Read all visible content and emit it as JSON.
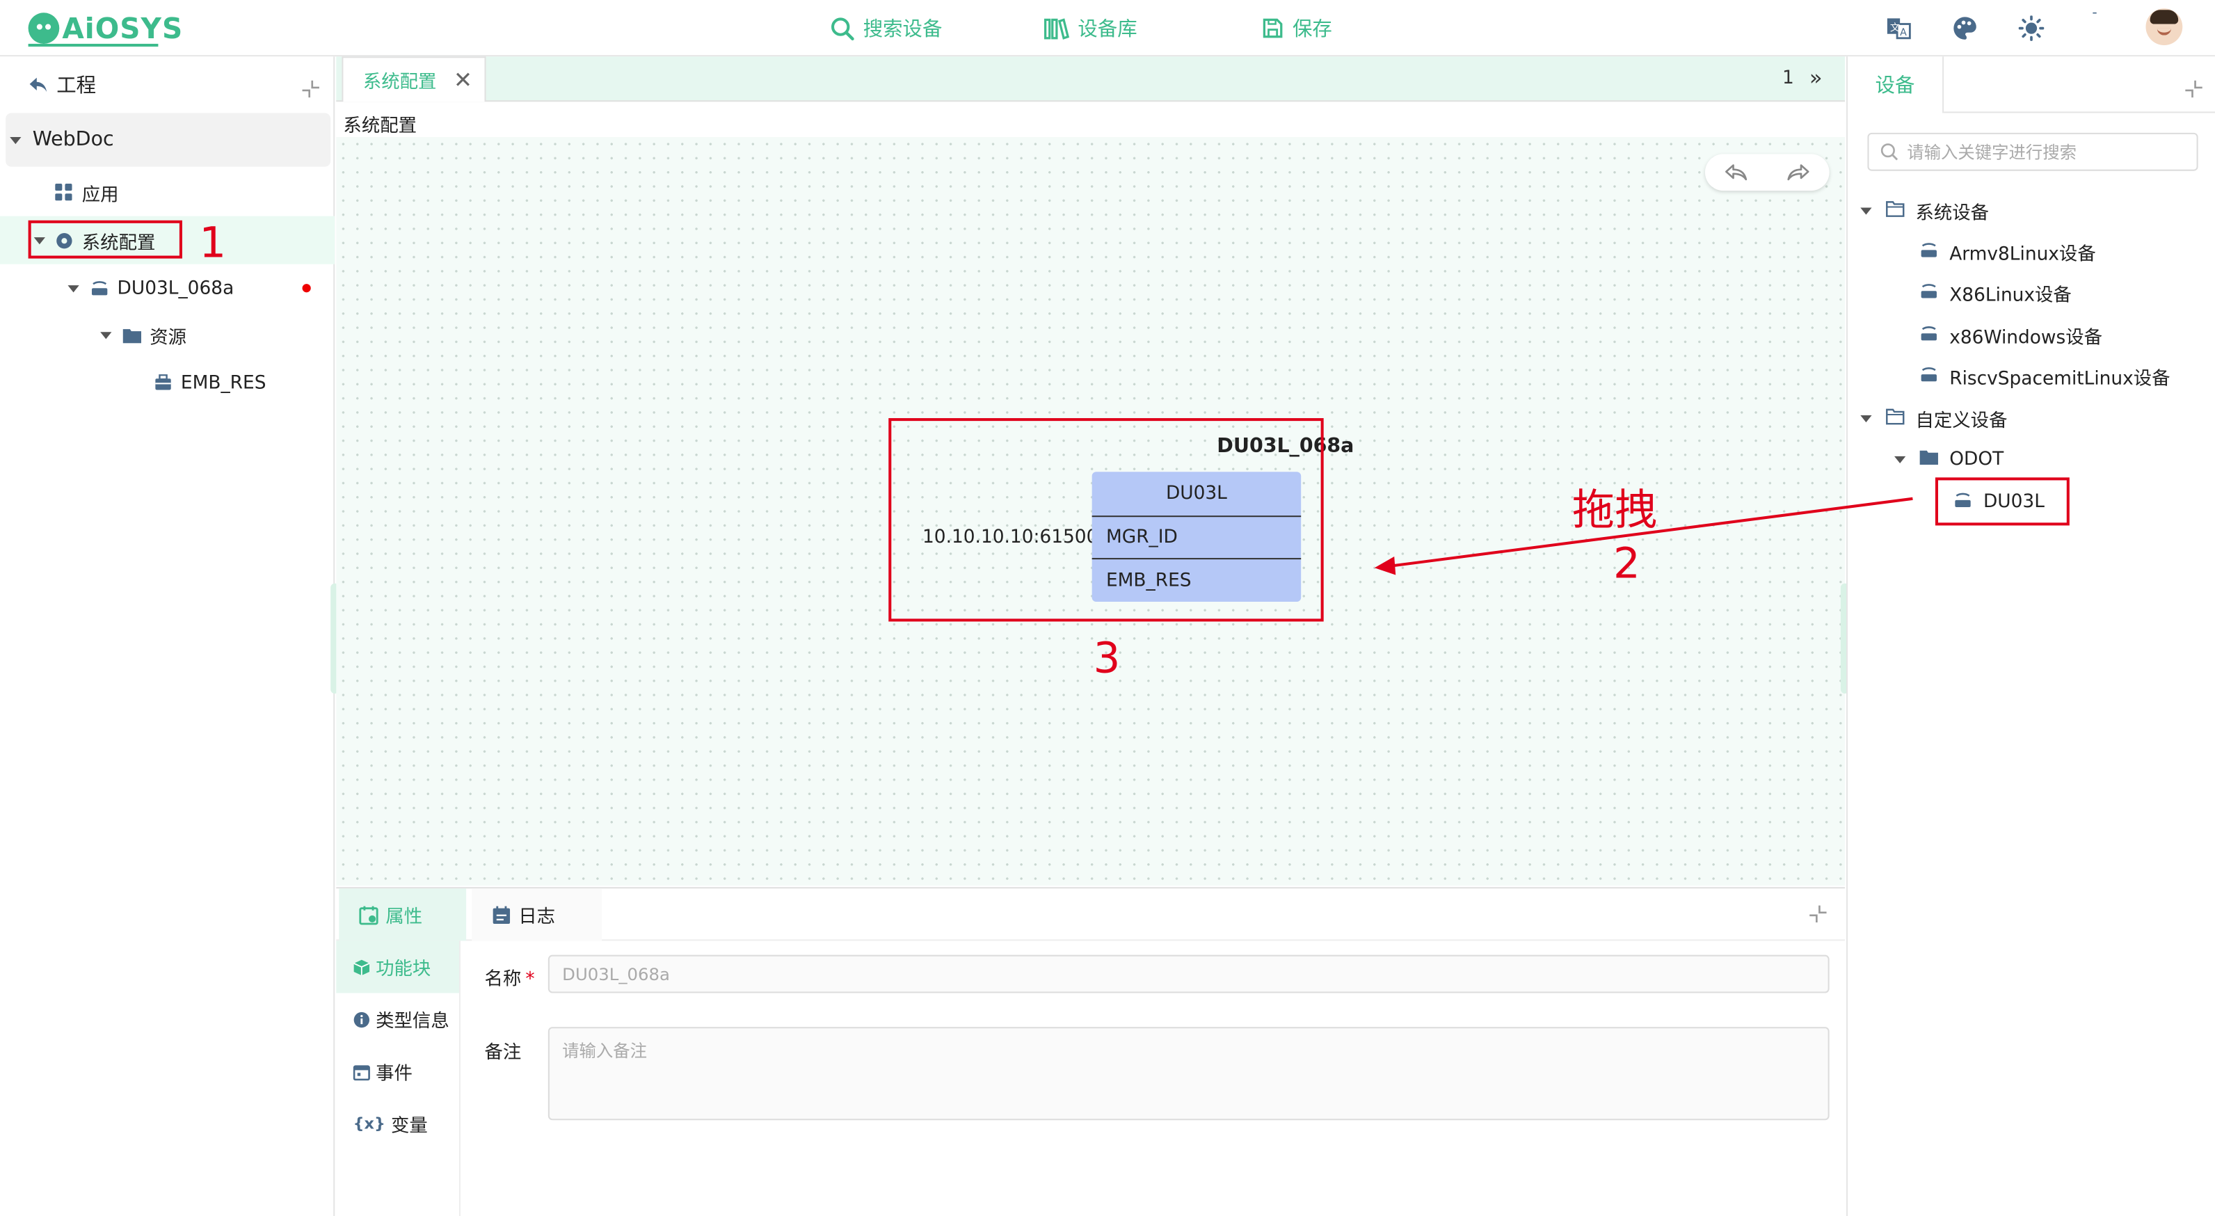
{
  "header": {
    "logo_text": "AiOSYS",
    "nav": [
      {
        "label": "搜索设备",
        "icon": "search-icon"
      },
      {
        "label": "设备库",
        "icon": "library-icon"
      },
      {
        "label": "保存",
        "icon": "save-icon"
      }
    ],
    "dash": "-",
    "icons": [
      "translate-icon",
      "palette-icon",
      "sun-icon",
      "avatar"
    ]
  },
  "left": {
    "title": "工程",
    "tree": [
      {
        "label": "WebDoc",
        "icon": "",
        "expanded": true
      },
      {
        "label": "应用",
        "icon": "apps-icon"
      },
      {
        "label": "系统配置",
        "icon": "gear-icon",
        "expanded": true,
        "selected": true
      },
      {
        "label": "DU03L_068a",
        "icon": "device-icon",
        "expanded": true,
        "modified": true
      },
      {
        "label": "资源",
        "icon": "folder-icon",
        "expanded": true
      },
      {
        "label": "EMB_RES",
        "icon": "resource-icon"
      }
    ]
  },
  "center": {
    "tab_label": "系统配置",
    "tab_close": "✕",
    "tab_count": "1",
    "tab_more": "»",
    "breadcrumb": "系统配置",
    "function_block": {
      "title": "DU03L_068a",
      "type": "DU03L",
      "ip": "10.10.10.10:61500",
      "rows": [
        "MGR_ID",
        "EMB_RES"
      ]
    }
  },
  "annotations": {
    "n1": "1",
    "n2": "2",
    "n3": "3",
    "drag_label": "拖拽"
  },
  "bottom": {
    "tabs": [
      {
        "label": "属性",
        "icon": "properties-icon",
        "active": true
      },
      {
        "label": "日志",
        "icon": "log-icon"
      }
    ],
    "side": [
      {
        "label": "功能块",
        "icon": "cube-icon",
        "active": true
      },
      {
        "label": "类型信息",
        "icon": "info-icon"
      },
      {
        "label": "事件",
        "icon": "calendar-icon"
      },
      {
        "label": "变量",
        "icon": "variable-icon"
      }
    ],
    "form": {
      "name_label": "名称",
      "required_mark": "*",
      "name_value": "DU03L_068a",
      "note_label": "备注",
      "note_placeholder": "请输入备注"
    }
  },
  "right": {
    "tab": "设备",
    "search_placeholder": "请输入关键字进行搜索",
    "tree": [
      {
        "label": "系统设备",
        "level": 0,
        "type": "folder",
        "expanded": true
      },
      {
        "label": "Armv8Linux设备",
        "level": 1,
        "type": "device"
      },
      {
        "label": "X86Linux设备",
        "level": 1,
        "type": "device"
      },
      {
        "label": "x86Windows设备",
        "level": 1,
        "type": "device"
      },
      {
        "label": "RiscvSpacemitLinux设备",
        "level": 1,
        "type": "device"
      },
      {
        "label": "自定义设备",
        "level": 0,
        "type": "folder",
        "expanded": true
      },
      {
        "label": "ODOT",
        "level": 1,
        "type": "folder-filled",
        "expanded": true
      },
      {
        "label": "DU03L",
        "level": 2,
        "type": "device"
      }
    ]
  },
  "colors": {
    "accent": "#3dbb8c",
    "annotation": "#e0001b",
    "block_fill": "#b5c8f7"
  }
}
